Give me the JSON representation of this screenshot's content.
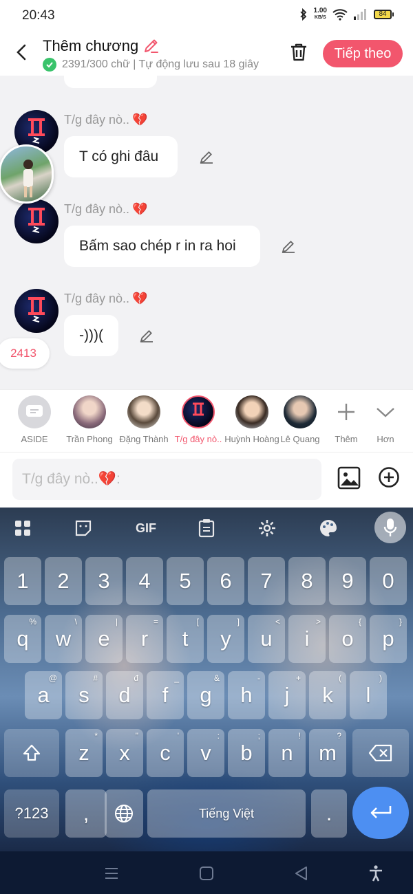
{
  "status_bar": {
    "time": "20:43",
    "net_speed_value": "1.00",
    "net_speed_unit": "KB/S",
    "battery": "84"
  },
  "header": {
    "title": "Thêm chương",
    "subtitle": "2391/300 chữ | Tự động lưu sau 18 giây",
    "next_label": "Tiếp theo"
  },
  "messages": [
    {
      "author": "T/g đây nò..",
      "text": "T có ghi đâu"
    },
    {
      "author": "T/g đây nò..",
      "text": "Bấm sao chép r in ra hoi"
    },
    {
      "author": "T/g đây nò..",
      "text": "-)))("
    }
  ],
  "word_count_badge": "2413",
  "characters": [
    {
      "label": "ASIDE"
    },
    {
      "label": "Trần Phong"
    },
    {
      "label": "Đặng Thành"
    },
    {
      "label": "T/g đây nò.."
    },
    {
      "label": "Huỳnh Hoàng"
    },
    {
      "label": "Lê Quang"
    },
    {
      "label": "Thêm"
    },
    {
      "label": "Hơn"
    }
  ],
  "composer": {
    "placeholder": "T/g đây nò..💔:"
  },
  "keyboard": {
    "number_row": [
      "1",
      "2",
      "3",
      "4",
      "5",
      "6",
      "7",
      "8",
      "9",
      "0"
    ],
    "row1": [
      {
        "k": "q",
        "s": "%"
      },
      {
        "k": "w",
        "s": "\\"
      },
      {
        "k": "e",
        "s": "|"
      },
      {
        "k": "r",
        "s": "="
      },
      {
        "k": "t",
        "s": "["
      },
      {
        "k": "y",
        "s": "]"
      },
      {
        "k": "u",
        "s": "<"
      },
      {
        "k": "i",
        "s": ">"
      },
      {
        "k": "o",
        "s": "{"
      },
      {
        "k": "p",
        "s": "}"
      }
    ],
    "row2": [
      {
        "k": "a",
        "s": "@"
      },
      {
        "k": "s",
        "s": "#"
      },
      {
        "k": "d",
        "s": "đ"
      },
      {
        "k": "f",
        "s": "_"
      },
      {
        "k": "g",
        "s": "&"
      },
      {
        "k": "h",
        "s": "-"
      },
      {
        "k": "j",
        "s": "+"
      },
      {
        "k": "k",
        "s": "("
      },
      {
        "k": "l",
        "s": ")"
      }
    ],
    "row3": [
      {
        "k": "z",
        "s": "*"
      },
      {
        "k": "x",
        "s": "\""
      },
      {
        "k": "c",
        "s": "'"
      },
      {
        "k": "v",
        "s": ":"
      },
      {
        "k": "b",
        "s": ";"
      },
      {
        "k": "n",
        "s": "!"
      },
      {
        "k": "m",
        "s": "?"
      }
    ],
    "symbols_label": "?123",
    "comma": ",",
    "space_label": "Tiếng Việt",
    "period": ".",
    "gif_label": "GIF"
  },
  "colors": {
    "accent": "#f2566d",
    "enter_key": "#4d8ff2",
    "chat_bg": "#f2f2f4",
    "check_green": "#39c36b"
  }
}
